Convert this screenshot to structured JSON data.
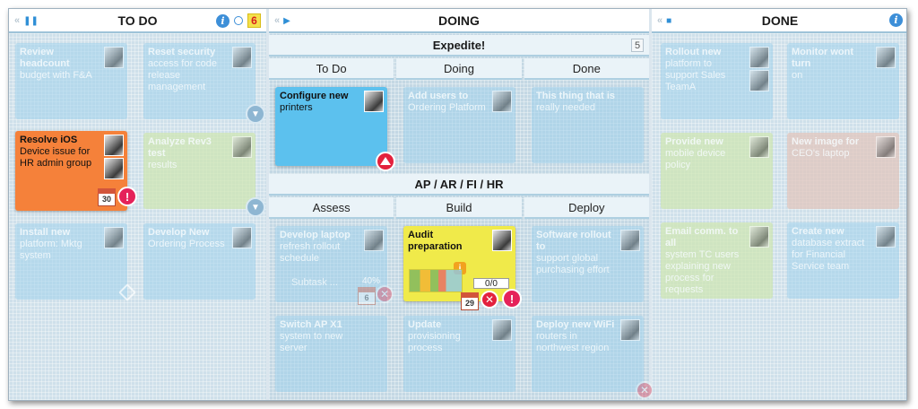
{
  "columns": {
    "todo": {
      "title": "TO DO",
      "wip": "6"
    },
    "doing": {
      "title": "DOING"
    },
    "done": {
      "title": "DONE"
    }
  },
  "lanes": {
    "expedite": {
      "title": "Expedite!",
      "count": "5",
      "subcolumns": [
        "To Do",
        "Doing",
        "Done"
      ]
    },
    "ap": {
      "title": "AP / AR / FI / HR",
      "subcolumns": [
        "Assess",
        "Build",
        "Deploy"
      ]
    }
  },
  "cards": {
    "review_headcount": {
      "title": "Review headcount",
      "sub": "budget with F&A"
    },
    "reset_security": {
      "title": "Reset security",
      "sub": "access for code release management"
    },
    "resolve_ios": {
      "title": "Resolve iOS",
      "sub": "Device issue for HR admin group",
      "date": "30"
    },
    "analyze_rev3": {
      "title": "Analyze Rev3 test",
      "sub": "results"
    },
    "install_new": {
      "title": "Install new",
      "sub": "platform: Mktg system"
    },
    "develop_new": {
      "title": "Develop New",
      "sub": "Ordering Process"
    },
    "configure_new": {
      "title": "Configure new",
      "sub": "printers"
    },
    "add_users": {
      "title": "Add users to",
      "sub": "Ordering Platform"
    },
    "this_thing": {
      "title": "This thing that is",
      "sub": "really needed"
    },
    "develop_laptop": {
      "title": "Develop laptop",
      "sub": "refresh rollout schedule",
      "subtask": "Subtask ...",
      "pct": "40%",
      "date": "6"
    },
    "audit_prep": {
      "title": "Audit preparation",
      "progress": "0/0",
      "date": "29"
    },
    "software_rollout": {
      "title": "Software rollout to",
      "sub": "support global purchasing effort"
    },
    "switch_ap": {
      "title": "Switch AP X1",
      "sub": "system to new server"
    },
    "update_prov": {
      "title": "Update",
      "sub": "provisioning process"
    },
    "deploy_wifi": {
      "title": "Deploy new WiFi",
      "sub": "routers in northwest region"
    },
    "rollout_new": {
      "title": "Rollout new",
      "sub": "platform to support Sales TeamA"
    },
    "monitor_wont": {
      "title": "Monitor wont turn",
      "sub": "on"
    },
    "provide_new": {
      "title": "Provide new",
      "sub": "mobile device policy"
    },
    "new_image": {
      "title": "New image for",
      "sub": "CEO's laptop"
    },
    "email_comm": {
      "title": "Email comm. to all",
      "sub": "system TC users explaining new process for requests"
    },
    "create_new": {
      "title": "Create new",
      "sub": "database extract for Financial Service team"
    }
  }
}
